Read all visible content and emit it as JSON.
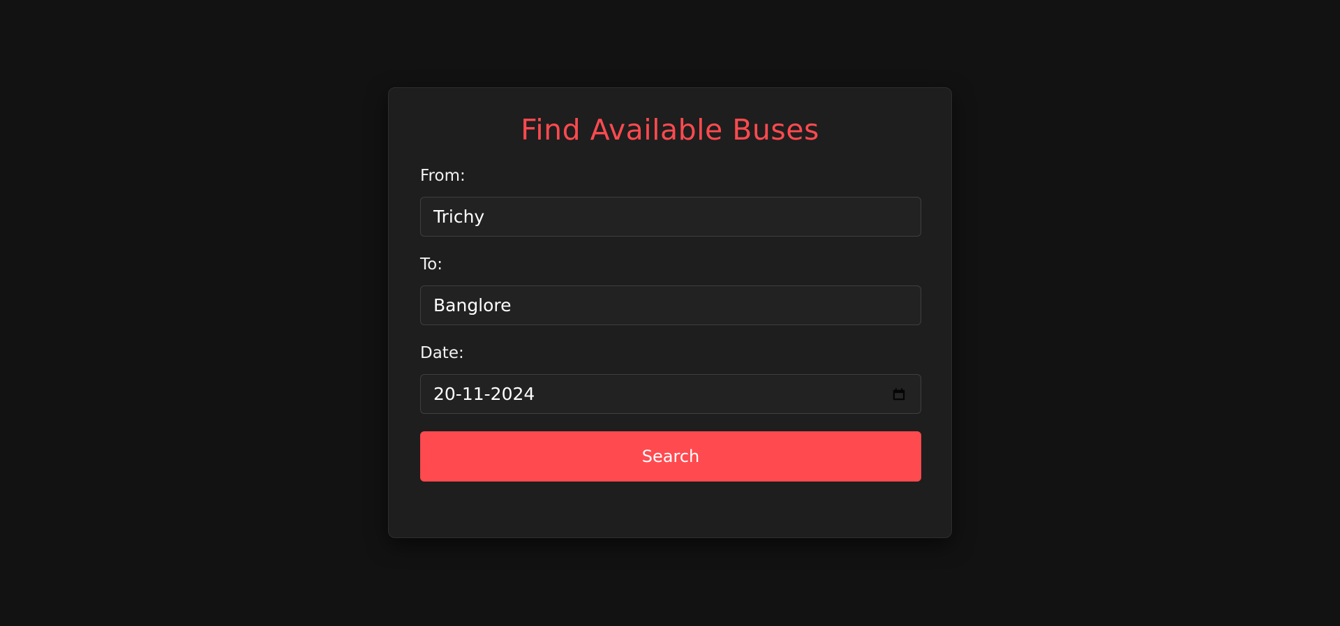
{
  "colors": {
    "background": "#121212",
    "card": "#1e1e1e",
    "accent": "#ff4a4f",
    "label_text": "#f2f2f2",
    "input_text": "#ffffff",
    "input_bg": "#222222",
    "input_border": "#3f3f3f"
  },
  "form": {
    "title": "Find Available Buses",
    "from": {
      "label": "From:",
      "value": "Trichy"
    },
    "to": {
      "label": "To:",
      "value": "Banglore"
    },
    "date": {
      "label": "Date:",
      "value": "20-11-2024",
      "icon": "calendar-icon"
    },
    "search_label": "Search"
  }
}
